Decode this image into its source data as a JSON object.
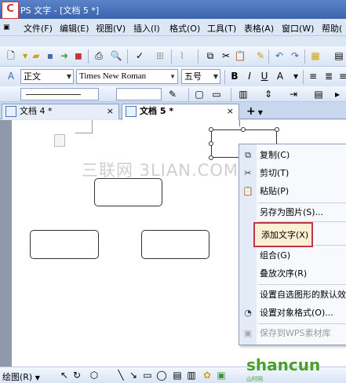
{
  "window": {
    "title": "PS 文字 - [文档 5 *]",
    "logo_glyph": "C"
  },
  "menu": [
    "文件(F)",
    "编辑(E)",
    "视图(V)",
    "插入(I)",
    "格式(O)",
    "工具(T)",
    "表格(A)",
    "窗口(W)",
    "帮助("
  ],
  "format_bar": {
    "style": "正文",
    "font": "Times New Roman",
    "size": "五号",
    "bold": "B",
    "italic": "I",
    "underline": "U"
  },
  "tabs": [
    {
      "label": "文档 4 *",
      "close": "×"
    },
    {
      "label": "文档 5 *",
      "close": "×"
    }
  ],
  "new_tab": "+",
  "watermark": "三联网 3LIAN.COM",
  "context_menu": {
    "items": [
      {
        "label": "复制(C)",
        "icon": "copy-icon"
      },
      {
        "label": "剪切(T)",
        "icon": "cut-icon"
      },
      {
        "label": "粘贴(P)",
        "icon": "paste-icon"
      },
      {
        "label": "另存为图片(S)..."
      },
      {
        "label": "添加文字(X)",
        "highlighted": true
      },
      {
        "label": "组合(G)"
      },
      {
        "label": "叠放次序(R)"
      },
      {
        "label": "设置自选图形的默认效果"
      },
      {
        "label": "设置对象格式(O)...",
        "icon": "format-object-icon"
      },
      {
        "label": "保存到WPS素材库",
        "disabled": true
      }
    ]
  },
  "draw_bar": {
    "label": "绘图(R)"
  },
  "site_logo": {
    "text": "shancun",
    "sub": "山村网"
  },
  "colors": {
    "highlight_border": "#c2344a",
    "titlebar": "#3b64ae"
  }
}
